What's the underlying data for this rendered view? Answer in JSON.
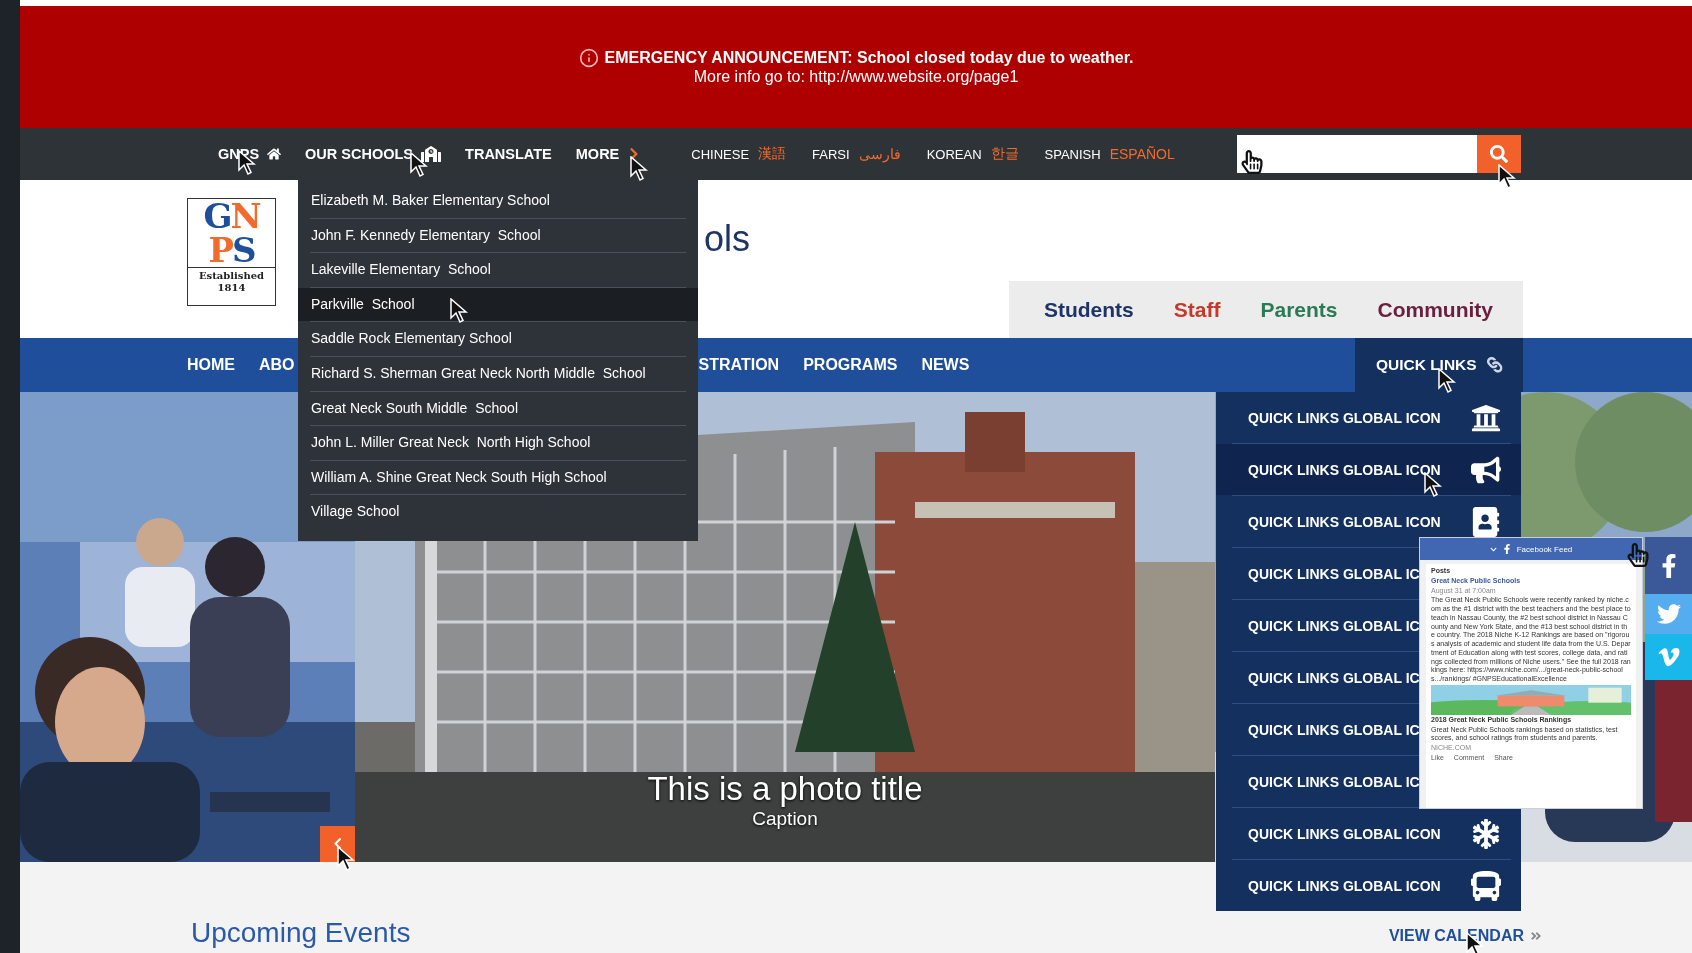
{
  "banner": {
    "headline": "EMERGENCY ANNOUNCEMENT: School closed today due to weather.",
    "detail": "More info go to: http://www.website.org/page1"
  },
  "top_nav": {
    "items": [
      {
        "label": "GNPS"
      },
      {
        "label": "OUR SCHOOLS",
        "expanded": true
      },
      {
        "label": "TRANSLATE"
      },
      {
        "label": "MORE"
      }
    ],
    "languages": [
      {
        "name": "CHINESE",
        "native": "漢語"
      },
      {
        "name": "FARSI",
        "native": "فارسی"
      },
      {
        "name": "KOREAN",
        "native": "한글"
      },
      {
        "name": "SPANISH",
        "native": "ESPAÑOL"
      }
    ]
  },
  "schools_menu": [
    {
      "label": "Elizabeth M. Baker Elementary School",
      "selected": false
    },
    {
      "label": "John F. Kennedy Elementary  School",
      "selected": false
    },
    {
      "label": "Lakeville Elementary  School",
      "selected": false
    },
    {
      "label": "Parkville  School",
      "selected": true
    },
    {
      "label": "Saddle Rock Elementary School",
      "selected": false
    },
    {
      "label": "Richard S. Sherman Great Neck North Middle  School",
      "selected": false
    },
    {
      "label": "Great Neck South Middle  School",
      "selected": false
    },
    {
      "label": "John L. Miller Great Neck  North High School",
      "selected": false
    },
    {
      "label": "William A. Shine Great Neck South High School",
      "selected": false
    },
    {
      "label": "Village School",
      "selected": false
    }
  ],
  "logo": {
    "rows": [
      "GN",
      "PS"
    ],
    "established": "Established",
    "year": "1814"
  },
  "site_title": "ols",
  "audience_links": [
    {
      "label": "Students",
      "color": "#1d3466"
    },
    {
      "label": "Staff",
      "color": "#c43a2a"
    },
    {
      "label": "Parents",
      "color": "#2c7a55"
    },
    {
      "label": "Community",
      "color": "#6a1f3f"
    }
  ],
  "main_nav": {
    "items": [
      "HOME",
      "ABO",
      "STRATION",
      "PROGRAMS",
      "NEWS"
    ],
    "quick_links": {
      "label": "QUICK LINKS",
      "expanded": true
    }
  },
  "quick_links": [
    {
      "label": "QUICK LINKS GLOBAL ICON",
      "kind": "bank",
      "selected": false
    },
    {
      "label": "QUICK LINKS GLOBAL ICON",
      "kind": "megaphone",
      "selected": true
    },
    {
      "label": "QUICK LINKS GLOBAL ICON",
      "kind": "contact",
      "selected": false
    },
    {
      "label": "QUICK LINKS GLOBAL IC",
      "selected": false
    },
    {
      "label": "QUICK LINKS GLOBAL IC",
      "selected": false
    },
    {
      "label": "QUICK LINKS GLOBAL IC",
      "selected": false
    },
    {
      "label": "QUICK LINKS GLOBAL IC",
      "selected": false
    },
    {
      "label": "QUICK LINKS GLOBAL IC",
      "selected": false
    },
    {
      "label": "QUICK LINKS GLOBAL ICON",
      "kind": "snowflake",
      "selected": false
    },
    {
      "label": "QUICK LINKS GLOBAL ICON",
      "kind": "bus",
      "selected": false
    }
  ],
  "slide": {
    "title": "This is a photo title",
    "caption": "Caption"
  },
  "facebook_feed": {
    "title": "Facebook Feed",
    "section": "Posts",
    "page": "Great Neck Public Schools",
    "time": "August 31 at 7:00am",
    "body": "The Great Neck Public Schools were recently ranked by niche.com as the #1 district with the best teachers and the best place to teach in Nassau County, the #2 best school district in Nassau County and New York State, and the #13 best school district in the country. The 2018 Niche K-12 Rankings are based on \"rigorous analysis of academic and student life data from the U.S. Department of Education along with test scores, college data, and ratings collected from millions of Niche users.\" See the full 2018 rankings here: https://www.niche.com/.../great-neck-public-schools.../rankings/ #GNPSEducationalExcellence",
    "card_title": "2018 Great Neck Public Schools Rankings",
    "card_text": "Great Neck Public Schools rankings based on statistics, test scores, and school ratings from students and parents.",
    "card_source": "NICHE.COM",
    "actions": [
      "Like",
      "Comment",
      "Share"
    ]
  },
  "social": [
    {
      "kind": "facebook"
    },
    {
      "kind": "twitter"
    },
    {
      "kind": "vimeo"
    }
  ],
  "events": {
    "heading": "Upcoming Events",
    "link": "VIEW CALENDAR"
  }
}
